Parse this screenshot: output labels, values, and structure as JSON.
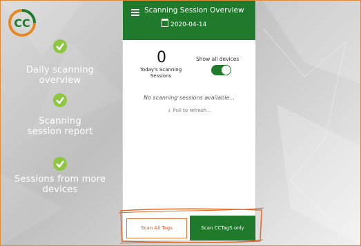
{
  "features": [
    {
      "label": "Daily scanning\noverview"
    },
    {
      "label": "Scanning\nsession report"
    },
    {
      "label": "Sessions from more\ndevices"
    }
  ],
  "app": {
    "title": "Scanning Session Overview",
    "date": "2020-04-14",
    "sessions_count": "0",
    "sessions_label": "Today's Scanning\nSessions",
    "show_all_label": "Show all devices",
    "show_all_enabled": true,
    "empty_message": "No scanning sessions available...",
    "refresh_hint": "↓ Pull to refresh...",
    "scan_all_button": "Scan All Tags",
    "scan_cc_button": "Scan CCTagS only"
  },
  "colors": {
    "brand_green": "#1f7a2c",
    "accent_orange": "#e07a3a"
  },
  "icons": [
    "cc-logo-icon",
    "check-circle-icon",
    "menu-icon",
    "calendar-icon"
  ]
}
